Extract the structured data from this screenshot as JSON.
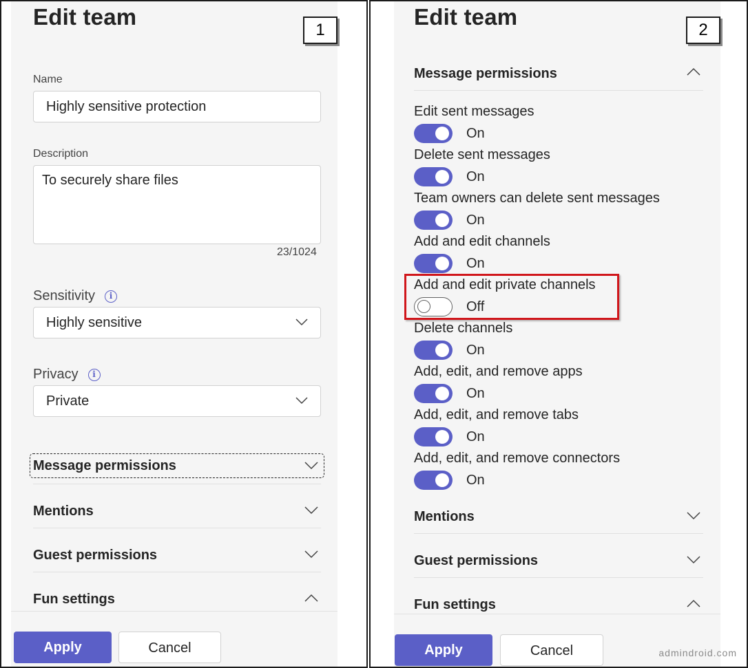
{
  "panel1": {
    "badge": "1",
    "title": "Edit team",
    "name": {
      "label": "Name",
      "value": "Highly sensitive protection"
    },
    "description": {
      "label": "Description",
      "value": "To securely share files",
      "counter": "23/1024"
    },
    "sensitivity": {
      "label": "Sensitivity",
      "value": "Highly sensitive"
    },
    "privacy": {
      "label": "Privacy",
      "value": "Private"
    },
    "sections": [
      {
        "label": "Message permissions",
        "state": "collapsed",
        "focused": true
      },
      {
        "label": "Mentions",
        "state": "collapsed"
      },
      {
        "label": "Guest permissions",
        "state": "collapsed"
      },
      {
        "label": "Fun settings",
        "state": "expanded"
      }
    ],
    "apply_label": "Apply",
    "cancel_label": "Cancel"
  },
  "panel2": {
    "badge": "2",
    "title": "Edit team",
    "message_permissions": {
      "label": "Message permissions",
      "state": "expanded",
      "toggles": [
        {
          "label": "Edit sent messages",
          "on": true,
          "state_text": "On"
        },
        {
          "label": "Delete sent messages",
          "on": true,
          "state_text": "On"
        },
        {
          "label": "Team owners can delete sent messages",
          "on": true,
          "state_text": "On"
        },
        {
          "label": "Add and edit channels",
          "on": true,
          "state_text": "On"
        },
        {
          "label": "Add and edit private channels",
          "on": false,
          "state_text": "Off",
          "highlighted": true
        },
        {
          "label": "Delete channels",
          "on": true,
          "state_text": "On"
        },
        {
          "label": "Add, edit, and remove apps",
          "on": true,
          "state_text": "On"
        },
        {
          "label": "Add, edit, and remove tabs",
          "on": true,
          "state_text": "On"
        },
        {
          "label": "Add, edit, and remove connectors",
          "on": true,
          "state_text": "On"
        }
      ]
    },
    "sections": [
      {
        "label": "Mentions",
        "state": "collapsed"
      },
      {
        "label": "Guest permissions",
        "state": "collapsed"
      },
      {
        "label": "Fun settings",
        "state": "expanded"
      }
    ],
    "apply_label": "Apply",
    "cancel_label": "Cancel"
  },
  "watermark": "admindroid.com",
  "colors": {
    "accent": "#5b5fc7",
    "highlight": "#d0161b",
    "pane": "#f5f5f5"
  },
  "icons": [
    "info-icon",
    "chevron-down-icon",
    "chevron-up-icon"
  ]
}
